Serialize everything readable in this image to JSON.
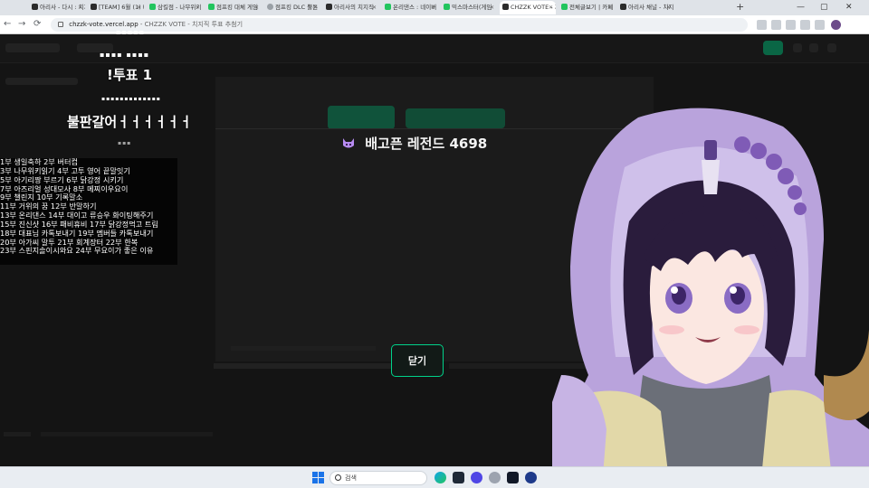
{
  "browser": {
    "tabs": [
      {
        "label": "아리사 - 다시 : 치지직",
        "favicon": "chzzk"
      },
      {
        "label": "[TEAM] 6월 (1) 태모베이",
        "favicon": "chzzk"
      },
      {
        "label": "삼킬점 - 나무위키",
        "favicon": "green"
      },
      {
        "label": "점프킹 대체 게임",
        "favicon": "green"
      },
      {
        "label": "점프킹 DLC 뿔튼",
        "favicon": "grey"
      },
      {
        "label": "아리사의 치지직",
        "favicon": "chzzk"
      },
      {
        "label": "온리댄스 : 네이버",
        "favicon": "green"
      },
      {
        "label": "믹스마스터(게임",
        "favicon": "green"
      },
      {
        "label": "CHZZK VOTE - 치지",
        "favicon": "chzzk"
      },
      {
        "label": "전체글보기 | 카페",
        "favicon": "green"
      },
      {
        "label": "아리사 채널 - 치지",
        "favicon": "chzzk"
      }
    ],
    "active_tab_index": 8,
    "new_tab_label": "+",
    "window_controls": {
      "minimize": "—",
      "maximize": "▢",
      "close": "✕"
    },
    "address": {
      "domain": "chzzk-vote.vercel.app",
      "page_title": "CHZZK VOTE - 치지직 투표 추첨기"
    },
    "nav": {
      "back": "←",
      "forward": "→",
      "reload": "⟳"
    }
  },
  "overlay": {
    "dots_top": "▪▪▪▪▪",
    "dots_mid": "▪▪▪▪ ▪▪▪▪",
    "heading_vote": "!투표 1",
    "dots_row": "▪▪▪▪▪▪▪▪▪▪▪▪▪",
    "heading_board": "불판갈어ㅓㅓㅓㅓㅓㅓ",
    "dots_small": "▪▪▪",
    "items": [
      "1부 생일축하 2부 버터컵",
      "3부 나무위키읽기 4부 고투 영어 끝말잇기",
      "5부 아기리짱 부르기 6부 닭강정 시키기",
      "7부 아즈리얼 성대모사 8부 메찌이우요이",
      "9부 챌린지 10부 기록말소",
      "11부 거위의 꿈 12부 반말하기",
      "13부 온리댄스 14부 대이고 류승우 화이팅해주기",
      "15부 진신샷 16부 패비휴비 17부 닭강정먹고 트림",
      "18부 대표님 카톡보내기 19부 멤버들 카톡보내기",
      "20부 아가씨 말투 21부 회계장터 22부 한복",
      "23부 스핀지솔이시와요 24부 무요이가 좋은 이유"
    ]
  },
  "modal": {
    "icon": "demon-face-icon",
    "winner_name": "배고픈 레전드",
    "winner_number": "4698",
    "close_label": "닫기"
  },
  "taskbar": {
    "search_placeholder": "검색"
  },
  "colors": {
    "accent": "#00d28a",
    "page_bg": "#141414",
    "avatar_hood": "#b9a3dc",
    "avatar_hair": "#2a1c3c"
  }
}
